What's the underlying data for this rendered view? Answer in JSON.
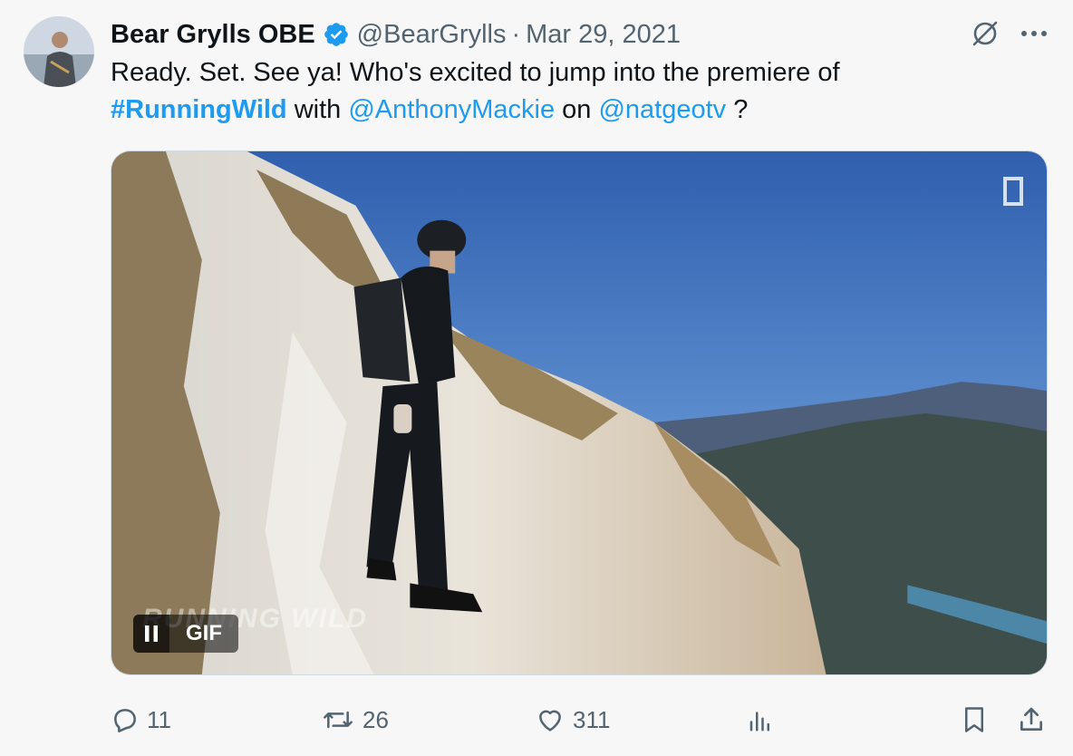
{
  "author": {
    "display_name": "Bear Grylls OBE",
    "handle": "@BearGrylls",
    "separator": "·",
    "date": "Mar 29, 2021",
    "verified_icon": "verified-badge-icon",
    "avatar_icon": "avatar"
  },
  "top_actions": {
    "grok_icon": "grok-icon",
    "more_icon": "more-icon"
  },
  "tweet": {
    "text_part1": "Ready. Set. See ya! Who's excited to jump into the premiere of",
    "hashtag": "#RunningWild",
    "text_with": "with",
    "mention1": "@AnthonyMackie",
    "text_on": "on",
    "mention2": "@natgeotv",
    "text_end": "?"
  },
  "media": {
    "gif_label": "GIF",
    "pause_icon": "pause-icon",
    "overlay_text": "RUNNING WILD"
  },
  "metrics": {
    "replies": "11",
    "reposts": "26",
    "likes": "311"
  },
  "colors": {
    "accent": "#1d9bf0",
    "text": "#0f1419",
    "muted": "#536471",
    "background": "#f7f7f7"
  }
}
